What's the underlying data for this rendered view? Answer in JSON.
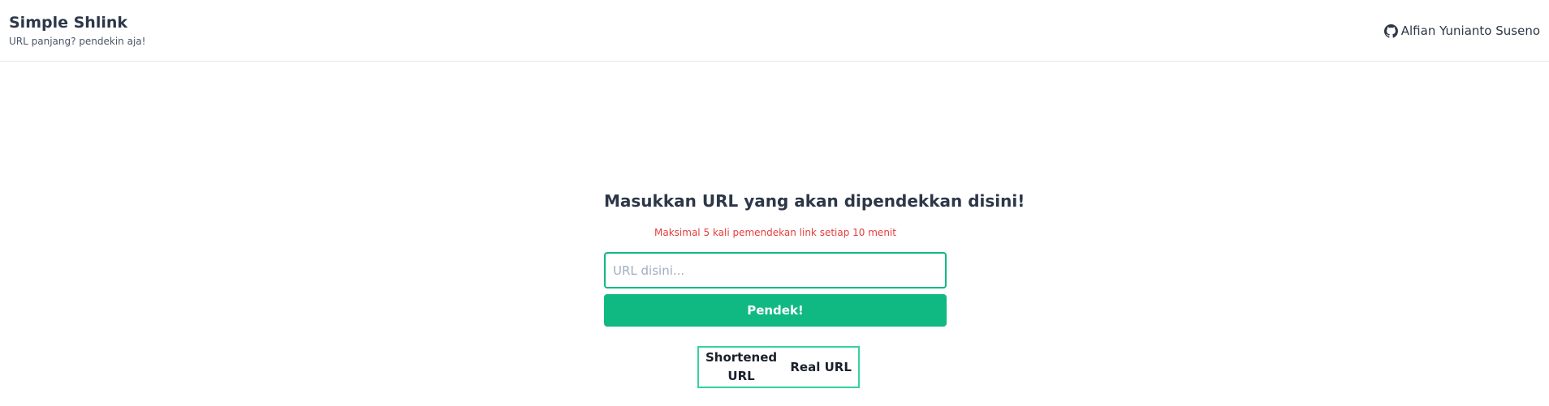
{
  "header": {
    "title": "Simple Shlink",
    "subtitle": "URL panjang? pendekin aja!",
    "author_name": "Alfian Yunianto Suseno",
    "author_icon": "github-icon"
  },
  "form": {
    "heading": "Masukkan URL yang akan dipendekkan disini!",
    "warning": "Maksimal 5 kali pemendekan link setiap 10 menit",
    "input_placeholder": "URL disini...",
    "input_value": "",
    "submit_label": "Pendek!"
  },
  "table": {
    "columns": [
      "Shortened URL",
      "Real URL"
    ],
    "rows": []
  },
  "colors": {
    "accent": "#10b981",
    "table_border": "#34d399",
    "warning": "#e53e3e",
    "text": "#2d3748"
  }
}
